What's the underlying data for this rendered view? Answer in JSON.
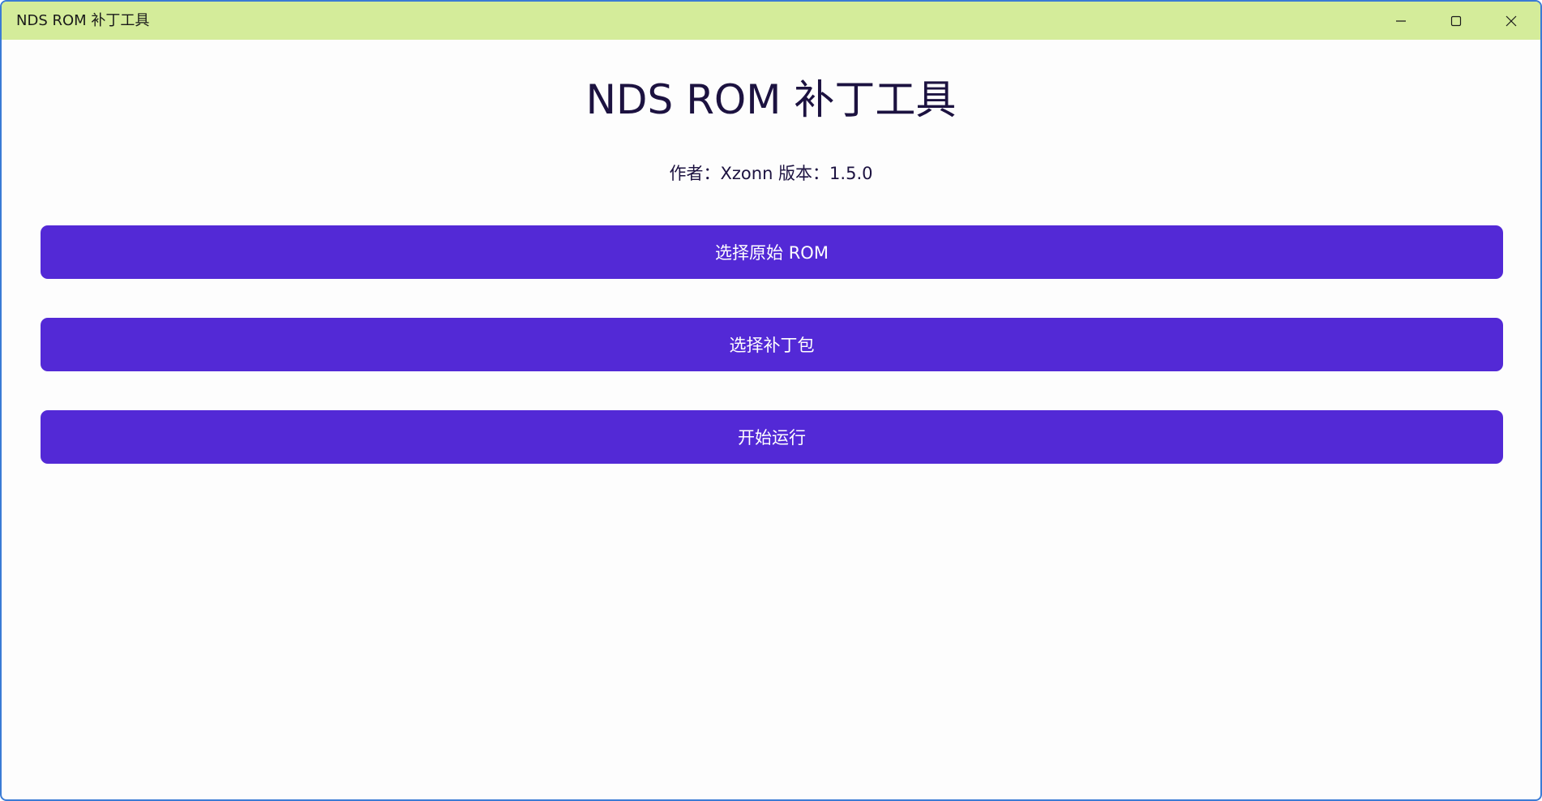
{
  "window": {
    "title": "NDS ROM 补丁工具",
    "controls": {
      "minimize_icon": "minimize-icon",
      "maximize_icon": "maximize-icon",
      "close_icon": "close-icon"
    }
  },
  "main": {
    "title": "NDS ROM 补丁工具",
    "author_line": "作者：Xzonn 版本：1.5.0",
    "buttons": [
      {
        "label": "选择原始 ROM"
      },
      {
        "label": "选择补丁包"
      },
      {
        "label": "开始运行"
      }
    ]
  },
  "colors": {
    "titlebar_bg": "#d4ec9a",
    "button_bg": "#5329d6",
    "title_text": "#1c1240",
    "window_border": "#3a7bd5"
  }
}
